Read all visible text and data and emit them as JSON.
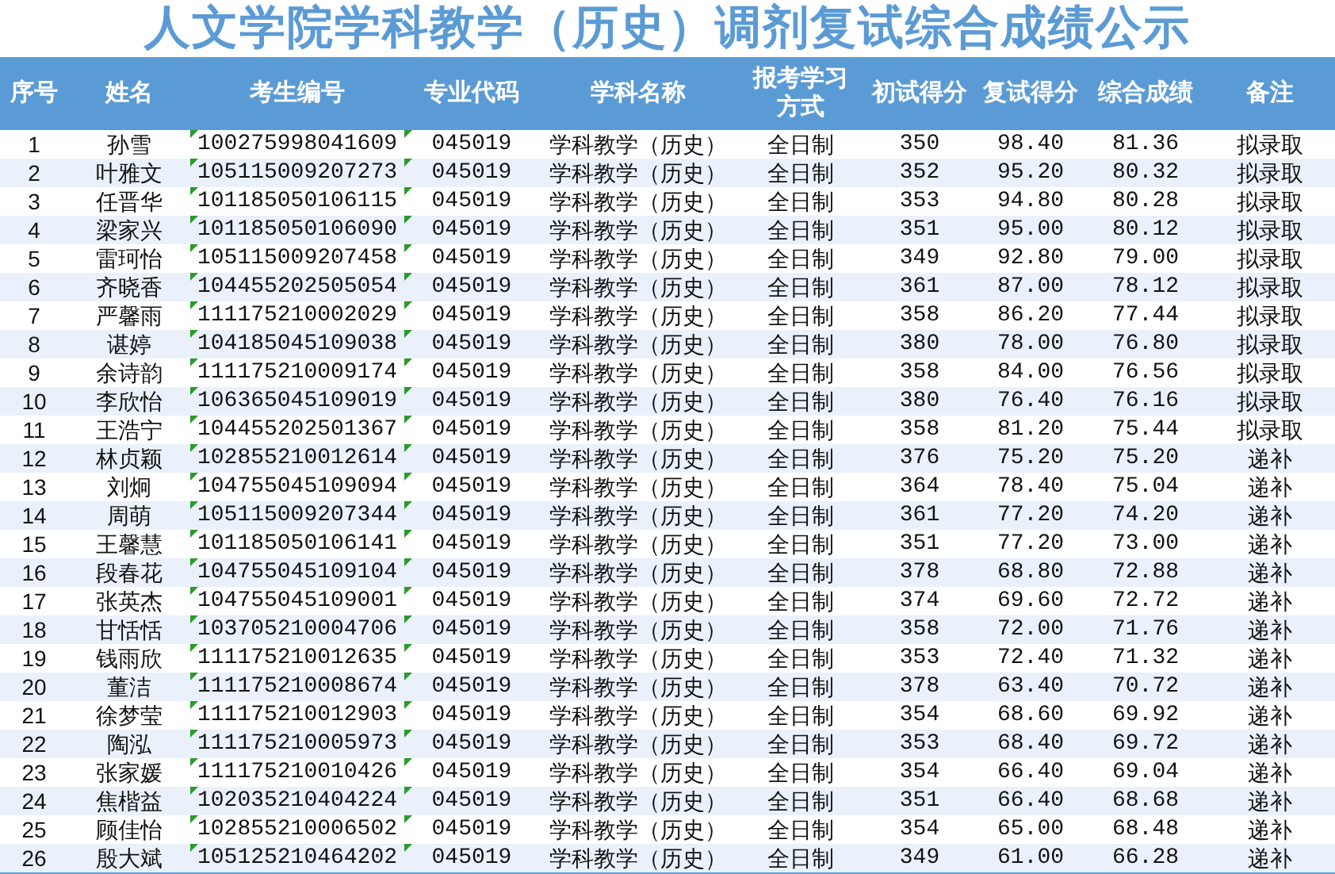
{
  "title": "人文学院学科教学（历史）调剂复试综合成绩公示",
  "columns": [
    "序号",
    "姓名",
    "考生编号",
    "专业代码",
    "学科名称",
    "报考学习方式",
    "初试得分",
    "复试得分",
    "综合成绩",
    "备注"
  ],
  "rows": [
    {
      "no": "1",
      "name": "孙雪",
      "exam_id": "100275998041609",
      "major_code": "045019",
      "subject": "学科教学（历史）",
      "study_mode": "全日制",
      "prelim": "350",
      "retest": "98.40",
      "total": "81.36",
      "remark": "拟录取"
    },
    {
      "no": "2",
      "name": "叶雅文",
      "exam_id": "105115009207273",
      "major_code": "045019",
      "subject": "学科教学（历史）",
      "study_mode": "全日制",
      "prelim": "352",
      "retest": "95.20",
      "total": "80.32",
      "remark": "拟录取"
    },
    {
      "no": "3",
      "name": "任晋华",
      "exam_id": "101185050106115",
      "major_code": "045019",
      "subject": "学科教学（历史）",
      "study_mode": "全日制",
      "prelim": "353",
      "retest": "94.80",
      "total": "80.28",
      "remark": "拟录取"
    },
    {
      "no": "4",
      "name": "梁家兴",
      "exam_id": "101185050106090",
      "major_code": "045019",
      "subject": "学科教学（历史）",
      "study_mode": "全日制",
      "prelim": "351",
      "retest": "95.00",
      "total": "80.12",
      "remark": "拟录取"
    },
    {
      "no": "5",
      "name": "雷珂怡",
      "exam_id": "105115009207458",
      "major_code": "045019",
      "subject": "学科教学（历史）",
      "study_mode": "全日制",
      "prelim": "349",
      "retest": "92.80",
      "total": "79.00",
      "remark": "拟录取"
    },
    {
      "no": "6",
      "name": "齐晓香",
      "exam_id": "104455202505054",
      "major_code": "045019",
      "subject": "学科教学（历史）",
      "study_mode": "全日制",
      "prelim": "361",
      "retest": "87.00",
      "total": "78.12",
      "remark": "拟录取"
    },
    {
      "no": "7",
      "name": "严馨雨",
      "exam_id": "111175210002029",
      "major_code": "045019",
      "subject": "学科教学（历史）",
      "study_mode": "全日制",
      "prelim": "358",
      "retest": "86.20",
      "total": "77.44",
      "remark": "拟录取"
    },
    {
      "no": "8",
      "name": "谌婷",
      "exam_id": "104185045109038",
      "major_code": "045019",
      "subject": "学科教学（历史）",
      "study_mode": "全日制",
      "prelim": "380",
      "retest": "78.00",
      "total": "76.80",
      "remark": "拟录取"
    },
    {
      "no": "9",
      "name": "余诗韵",
      "exam_id": "111175210009174",
      "major_code": "045019",
      "subject": "学科教学（历史）",
      "study_mode": "全日制",
      "prelim": "358",
      "retest": "84.00",
      "total": "76.56",
      "remark": "拟录取"
    },
    {
      "no": "10",
      "name": "李欣怡",
      "exam_id": "106365045109019",
      "major_code": "045019",
      "subject": "学科教学（历史）",
      "study_mode": "全日制",
      "prelim": "380",
      "retest": "76.40",
      "total": "76.16",
      "remark": "拟录取"
    },
    {
      "no": "11",
      "name": "王浩宁",
      "exam_id": "104455202501367",
      "major_code": "045019",
      "subject": "学科教学（历史）",
      "study_mode": "全日制",
      "prelim": "358",
      "retest": "81.20",
      "total": "75.44",
      "remark": "拟录取"
    },
    {
      "no": "12",
      "name": "林贞颖",
      "exam_id": "102855210012614",
      "major_code": "045019",
      "subject": "学科教学（历史）",
      "study_mode": "全日制",
      "prelim": "376",
      "retest": "75.20",
      "total": "75.20",
      "remark": "递补"
    },
    {
      "no": "13",
      "name": "刘炯",
      "exam_id": "104755045109094",
      "major_code": "045019",
      "subject": "学科教学（历史）",
      "study_mode": "全日制",
      "prelim": "364",
      "retest": "78.40",
      "total": "75.04",
      "remark": "递补"
    },
    {
      "no": "14",
      "name": "周萌",
      "exam_id": "105115009207344",
      "major_code": "045019",
      "subject": "学科教学（历史）",
      "study_mode": "全日制",
      "prelim": "361",
      "retest": "77.20",
      "total": "74.20",
      "remark": "递补"
    },
    {
      "no": "15",
      "name": "王馨慧",
      "exam_id": "101185050106141",
      "major_code": "045019",
      "subject": "学科教学（历史）",
      "study_mode": "全日制",
      "prelim": "351",
      "retest": "77.20",
      "total": "73.00",
      "remark": "递补"
    },
    {
      "no": "16",
      "name": "段春花",
      "exam_id": "104755045109104",
      "major_code": "045019",
      "subject": "学科教学（历史）",
      "study_mode": "全日制",
      "prelim": "378",
      "retest": "68.80",
      "total": "72.88",
      "remark": "递补"
    },
    {
      "no": "17",
      "name": "张英杰",
      "exam_id": "104755045109001",
      "major_code": "045019",
      "subject": "学科教学（历史）",
      "study_mode": "全日制",
      "prelim": "374",
      "retest": "69.60",
      "total": "72.72",
      "remark": "递补"
    },
    {
      "no": "18",
      "name": "甘恬恬",
      "exam_id": "103705210004706",
      "major_code": "045019",
      "subject": "学科教学（历史）",
      "study_mode": "全日制",
      "prelim": "358",
      "retest": "72.00",
      "total": "71.76",
      "remark": "递补"
    },
    {
      "no": "19",
      "name": "钱雨欣",
      "exam_id": "111175210012635",
      "major_code": "045019",
      "subject": "学科教学（历史）",
      "study_mode": "全日制",
      "prelim": "353",
      "retest": "72.40",
      "total": "71.32",
      "remark": "递补"
    },
    {
      "no": "20",
      "name": "董洁",
      "exam_id": "111175210008674",
      "major_code": "045019",
      "subject": "学科教学（历史）",
      "study_mode": "全日制",
      "prelim": "378",
      "retest": "63.40",
      "total": "70.72",
      "remark": "递补"
    },
    {
      "no": "21",
      "name": "徐梦莹",
      "exam_id": "111175210012903",
      "major_code": "045019",
      "subject": "学科教学（历史）",
      "study_mode": "全日制",
      "prelim": "354",
      "retest": "68.60",
      "total": "69.92",
      "remark": "递补"
    },
    {
      "no": "22",
      "name": "陶泓",
      "exam_id": "111175210005973",
      "major_code": "045019",
      "subject": "学科教学（历史）",
      "study_mode": "全日制",
      "prelim": "353",
      "retest": "68.40",
      "total": "69.72",
      "remark": "递补"
    },
    {
      "no": "23",
      "name": "张家媛",
      "exam_id": "111175210010426",
      "major_code": "045019",
      "subject": "学科教学（历史）",
      "study_mode": "全日制",
      "prelim": "354",
      "retest": "66.40",
      "total": "69.04",
      "remark": "递补"
    },
    {
      "no": "24",
      "name": "焦楷益",
      "exam_id": "102035210404224",
      "major_code": "045019",
      "subject": "学科教学（历史）",
      "study_mode": "全日制",
      "prelim": "351",
      "retest": "66.40",
      "total": "68.68",
      "remark": "递补"
    },
    {
      "no": "25",
      "name": "顾佳怡",
      "exam_id": "102855210006502",
      "major_code": "045019",
      "subject": "学科教学（历史）",
      "study_mode": "全日制",
      "prelim": "354",
      "retest": "65.00",
      "total": "68.48",
      "remark": "递补"
    },
    {
      "no": "26",
      "name": "殷大斌",
      "exam_id": "105125210464202",
      "major_code": "045019",
      "subject": "学科教学（历史）",
      "study_mode": "全日制",
      "prelim": "349",
      "retest": "61.00",
      "total": "66.28",
      "remark": "递补"
    }
  ]
}
